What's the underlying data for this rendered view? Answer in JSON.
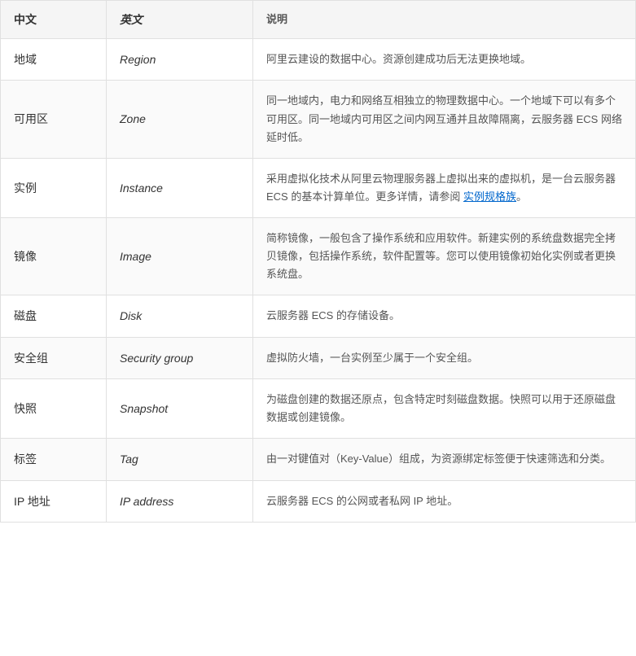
{
  "table": {
    "headers": {
      "chinese": "中文",
      "english": "英文",
      "description": "说明"
    },
    "rows": [
      {
        "chinese": "地域",
        "english": "Region",
        "description": "阿里云建设的数据中心。资源创建成功后无法更换地域。",
        "hasLink": false
      },
      {
        "chinese": "可用区",
        "english": "Zone",
        "description": "同一地域内，电力和网络互相独立的物理数据中心。一个地域下可以有多个可用区。同一地域内可用区之间内网互通并且故障隔离，云服务器 ECS 网络延时低。",
        "hasLink": false
      },
      {
        "chinese": "实例",
        "english": "Instance",
        "description_before": "采用虚拟化技术从阿里云物理服务器上虚拟出来的虚拟机，是一台云服务器 ECS 的基本计算单位。更多详情，请参阅 ",
        "link_text": "实例规格族",
        "description_after": "。",
        "hasLink": true
      },
      {
        "chinese": "镜像",
        "english": "Image",
        "description": "简称镜像，一般包含了操作系统和应用软件。新建实例的系统盘数据完全拷贝镜像，包括操作系统，软件配置等。您可以使用镜像初始化实例或者更换系统盘。",
        "hasLink": false
      },
      {
        "chinese": "磁盘",
        "english": "Disk",
        "description": "云服务器 ECS 的存储设备。",
        "hasLink": false
      },
      {
        "chinese": "安全组",
        "english": "Security group",
        "description": "虚拟防火墙，一台实例至少属于一个安全组。",
        "hasLink": false
      },
      {
        "chinese": "快照",
        "english": "Snapshot",
        "description": "为磁盘创建的数据还原点，包含特定时刻磁盘数据。快照可以用于还原磁盘数据或创建镜像。",
        "hasLink": false
      },
      {
        "chinese": "标签",
        "english": "Tag",
        "description": "由一对键值对（Key-Value）组成，为资源绑定标签便于快速筛选和分类。",
        "hasLink": false
      },
      {
        "chinese": "IP 地址",
        "english": "IP address",
        "description": "云服务器 ECS 的公网或者私网 IP 地址。",
        "hasLink": false
      }
    ]
  }
}
